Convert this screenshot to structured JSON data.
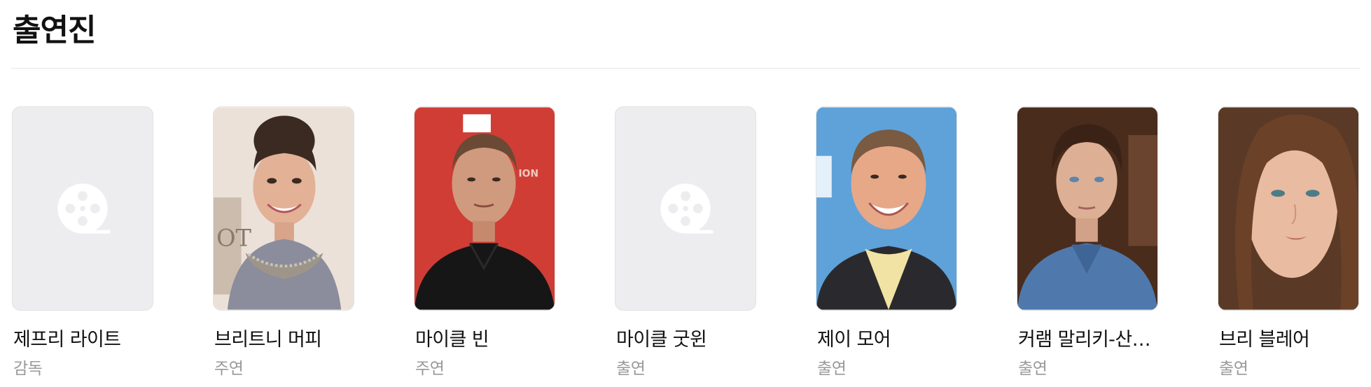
{
  "section": {
    "title": "출연진"
  },
  "cast": [
    {
      "name": "제프리 라이트",
      "role": "감독",
      "photo": "placeholder-film-reel-icon"
    },
    {
      "name": "브리트니 머피",
      "role": "주연",
      "photo": "portrait-photo"
    },
    {
      "name": "마이클 빈",
      "role": "주연",
      "photo": "portrait-photo"
    },
    {
      "name": "마이클 굿윈",
      "role": "출연",
      "photo": "placeholder-film-reel-icon"
    },
    {
      "name": "제이 모어",
      "role": "출연",
      "photo": "portrait-photo"
    },
    {
      "name": "커램 말리키-산…",
      "role": "출연",
      "photo": "portrait-photo"
    },
    {
      "name": "브리 블레어",
      "role": "출연",
      "photo": "portrait-photo"
    }
  ],
  "colors": {
    "placeholder_bg": "#ededf0",
    "placeholder_icon": "#ffffff",
    "role_text": "#999999",
    "divider": "#e6e6e6"
  }
}
